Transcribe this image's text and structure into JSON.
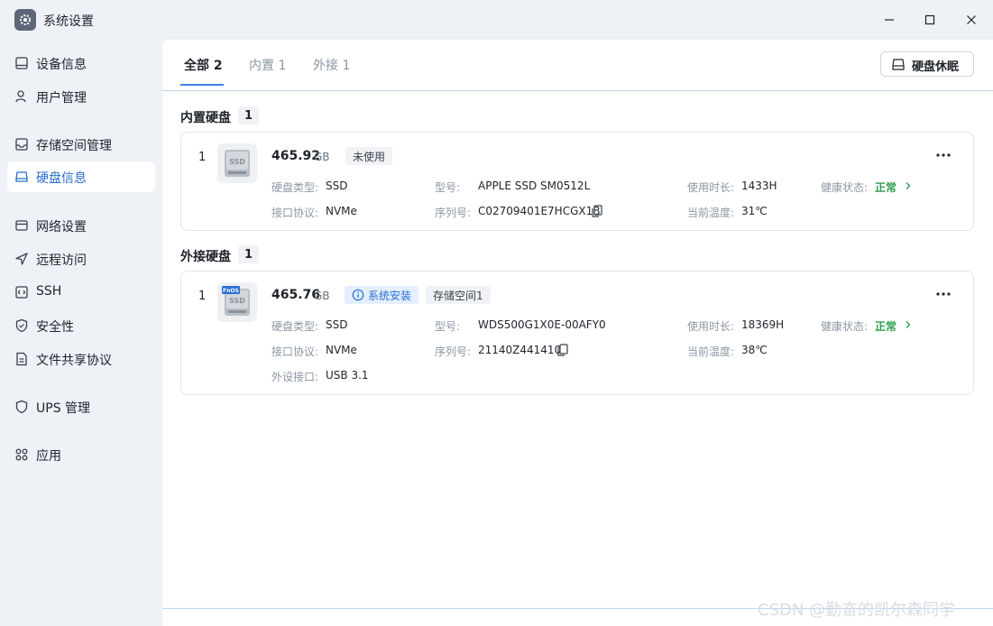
{
  "window": {
    "title": "系统设置",
    "controls": [
      "minimize-icon",
      "maximize-icon",
      "close-icon"
    ]
  },
  "sidebar": {
    "items": [
      {
        "label": "设备信息",
        "icon": "device-icon"
      },
      {
        "label": "用户管理",
        "icon": "user-icon"
      },
      {
        "label": "存储空间管理",
        "icon": "storage-icon"
      },
      {
        "label": "硬盘信息",
        "icon": "disk-icon",
        "active": true
      },
      {
        "label": "网络设置",
        "icon": "network-icon"
      },
      {
        "label": "远程访问",
        "icon": "send-icon"
      },
      {
        "label": "SSH",
        "icon": "code-icon"
      },
      {
        "label": "安全性",
        "icon": "shield-check-icon"
      },
      {
        "label": "文件共享协议",
        "icon": "file-icon"
      },
      {
        "label": "UPS 管理",
        "icon": "shield-icon"
      },
      {
        "label": "应用",
        "icon": "apps-icon"
      }
    ]
  },
  "tabs": [
    {
      "label": "全部 2",
      "active": true
    },
    {
      "label": "内置 1"
    },
    {
      "label": "外接 1"
    }
  ],
  "toolbar": {
    "hibernate_label": "硬盘休眠"
  },
  "internal": {
    "title": "内置硬盘",
    "count": "1",
    "disk": {
      "index": "1",
      "capacity": "465.92",
      "unit": "GB",
      "tags": [
        "未使用"
      ],
      "type_label": "硬盘类型:",
      "type": "SSD",
      "model_label": "型号:",
      "model": "APPLE SSD SM0512L",
      "hours_label": "使用时长:",
      "hours": "1433H",
      "health_label": "健康状态:",
      "health": "正常",
      "interface_label": "接口协议:",
      "interface": "NVMe",
      "serial_label": "序列号:",
      "serial": "C02709401E7HCGX1B",
      "temp_label": "当前温度:",
      "temp": "31℃"
    }
  },
  "external": {
    "title": "外接硬盘",
    "count": "1",
    "disk": {
      "index": "1",
      "capacity": "465.76",
      "unit": "GB",
      "badge": "FnOS",
      "tag_system": "系统安装",
      "tag_storage": "存储空间1",
      "type_label": "硬盘类型:",
      "type": "SSD",
      "model_label": "型号:",
      "model": "WDS500G1X0E-00AFY0",
      "hours_label": "使用时长:",
      "hours": "18369H",
      "health_label": "健康状态:",
      "health": "正常",
      "interface_label": "接口协议:",
      "interface": "NVMe",
      "serial_label": "序列号:",
      "serial": "21140Z441410",
      "temp_label": "当前温度:",
      "temp": "38℃",
      "port_label": "外设接口:",
      "port": "USB 3.1"
    }
  },
  "watermark": "CSDN @勤奋的凯尔森同学",
  "colors": {
    "accent": "#3b82e0",
    "healthy": "#2e9e4f"
  }
}
